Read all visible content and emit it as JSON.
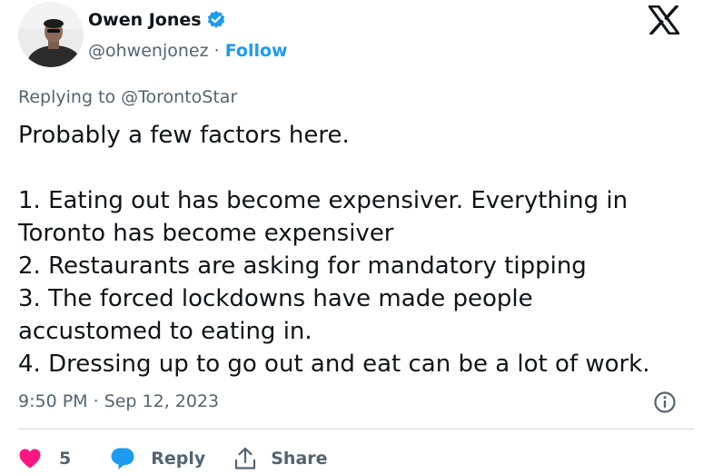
{
  "author": {
    "name": "Owen Jones",
    "handle": "@ohwenjonez",
    "separator": "·",
    "follow_label": "Follow",
    "verified_color": "#1d9bf0"
  },
  "logo_icon": "x-logo-icon",
  "reply_context": {
    "prefix": "Replying to ",
    "target": "@TorontoStar"
  },
  "tweet": {
    "lines": [
      "Probably a few factors here.",
      "",
      "1. Eating out has become expensiver. Everything in",
      "Toronto has become expensiver",
      "2. Restaurants are asking for mandatory tipping",
      "3. The forced lockdowns have made people",
      "accustomed to eating in.",
      "4. Dressing up to go out and eat can be a lot of work."
    ]
  },
  "timestamp": "9:50 PM · Sep 12, 2023",
  "actions": {
    "like_count": "5",
    "reply_label": "Reply",
    "share_label": "Share"
  },
  "colors": {
    "accent": "#1d9bf0",
    "like": "#f91880",
    "secondary_text": "#536471",
    "primary_text": "#0f1419",
    "divider": "#cfd9de"
  }
}
